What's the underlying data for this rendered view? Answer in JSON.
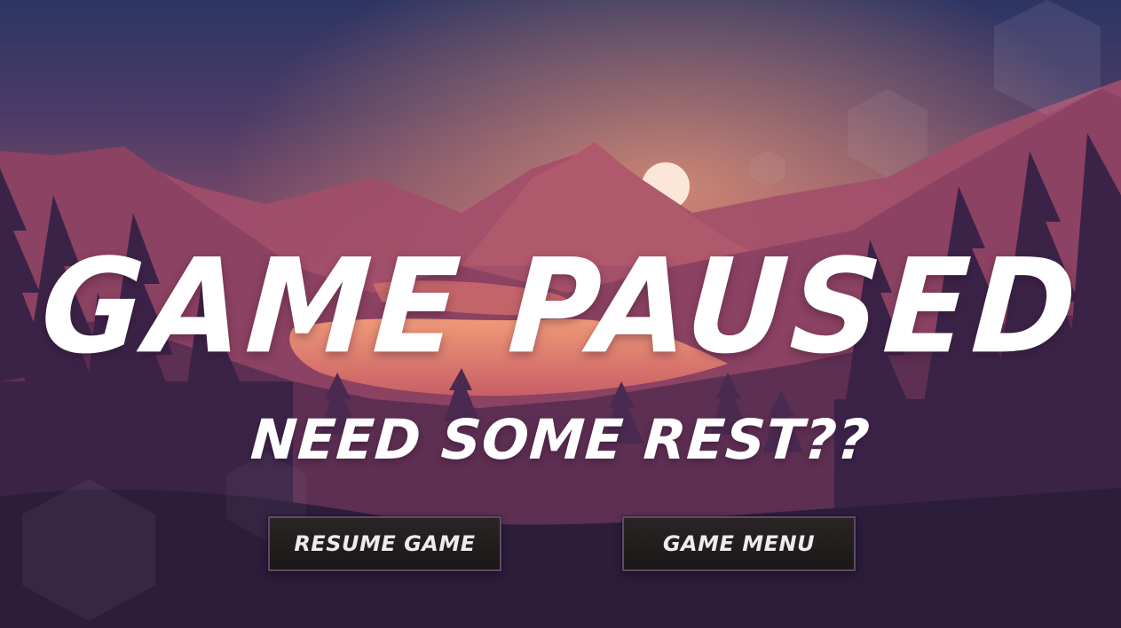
{
  "pause_screen": {
    "title": "GAME PAUSED",
    "subtitle": "NEED SOME REST??",
    "buttons": {
      "resume_label": "RESUME GAME",
      "menu_label": "GAME MENU"
    }
  },
  "colors": {
    "sky_top": "#2e3563",
    "sky_mid": "#7a4a6a",
    "sky_glow": "#d9725a",
    "mountain_far": "#a8506a",
    "mountain_near": "#6b3356",
    "forest": "#3a2346",
    "foreground": "#2a1c3a",
    "lake": "#e07a6a",
    "text": "#ffffff",
    "button_bg": "#201b1b",
    "button_border": "#5e4a68"
  }
}
